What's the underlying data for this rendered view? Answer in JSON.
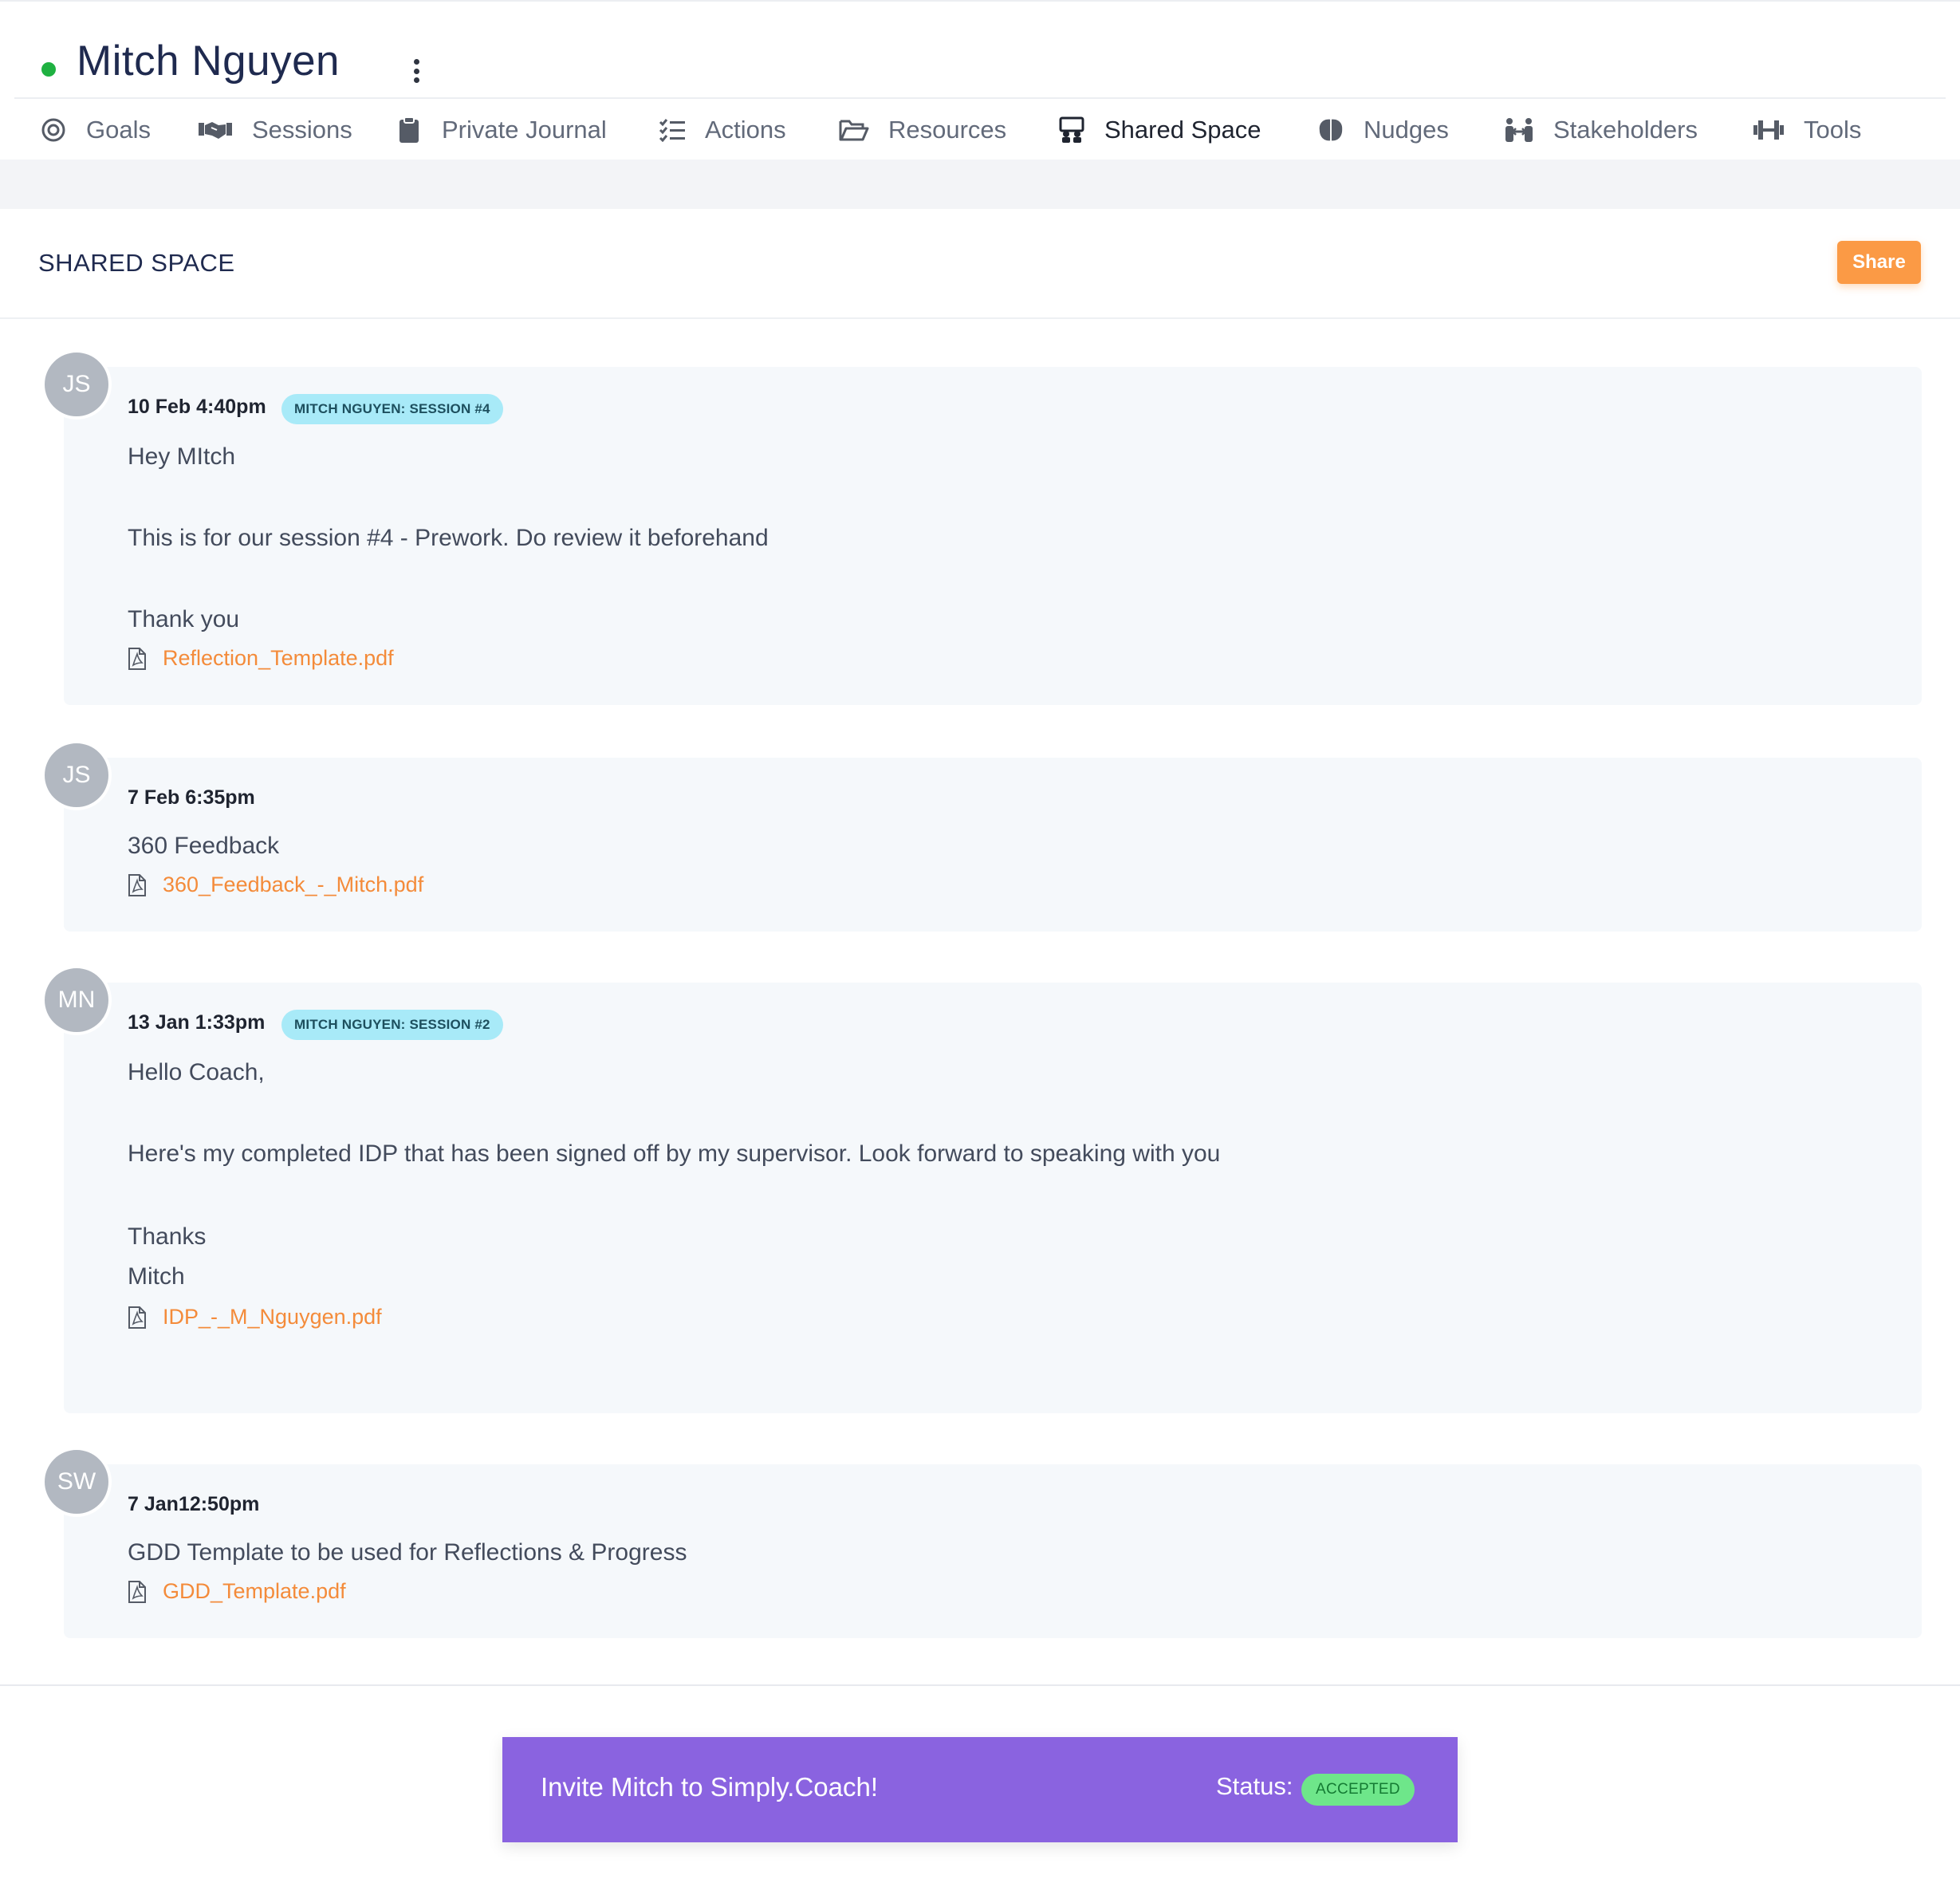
{
  "header": {
    "user_name": "Mitch Nguyen",
    "status_color": "#1fb141",
    "more_icon": "kebab-menu-icon"
  },
  "tabs": [
    {
      "label": "Goals",
      "icon": "target-icon",
      "active": false
    },
    {
      "label": "Sessions",
      "icon": "handshake-icon",
      "active": false
    },
    {
      "label": "Private Journal",
      "icon": "clipboard-icon",
      "active": false
    },
    {
      "label": "Actions",
      "icon": "checklist-icon",
      "active": false
    },
    {
      "label": "Resources",
      "icon": "folder-open-icon",
      "active": false
    },
    {
      "label": "Shared Space",
      "icon": "shared-space-icon",
      "active": true
    },
    {
      "label": "Nudges",
      "icon": "brain-icon",
      "active": false
    },
    {
      "label": "Stakeholders",
      "icon": "people-icon",
      "active": false
    },
    {
      "label": "Tools",
      "icon": "dumbbell-icon",
      "active": false
    }
  ],
  "panel": {
    "title": "SHARED SPACE",
    "share_label": "Share",
    "accent_color": "#fb9a45"
  },
  "messages": [
    {
      "initials": "JS",
      "timestamp": "10 Feb 4:40pm",
      "badge": "MITCH NGUYEN: SESSION #4",
      "lines": [
        "Hey MItch",
        "This is for our session #4 - Prework. Do review it beforehand",
        "Thank you"
      ],
      "attachment": "Reflection_Template.pdf"
    },
    {
      "initials": "JS",
      "timestamp": "7 Feb 6:35pm",
      "badge": "",
      "lines": [
        "360 Feedback"
      ],
      "attachment": "360_Feedback_-_Mitch.pdf"
    },
    {
      "initials": "MN",
      "timestamp": "13 Jan 1:33pm",
      "badge": "MITCH NGUYEN: SESSION #2",
      "lines": [
        "Hello Coach,",
        "Here's my completed IDP that has been signed off by my supervisor. Look forward to speaking with you",
        "Thanks",
        "Mitch"
      ],
      "attachment": "IDP_-_M_Nguygen.pdf"
    },
    {
      "initials": "SW",
      "timestamp": "7 Jan12:50pm",
      "badge": "",
      "lines": [
        "GDD Template to be used for Reflections & Progress"
      ],
      "attachment": "GDD_Template.pdf"
    }
  ],
  "invite": {
    "text": "Invite Mitch to Simply.Coach!",
    "status_label": "Status:",
    "status_value": "ACCEPTED",
    "banner_color": "#8a63e0"
  }
}
